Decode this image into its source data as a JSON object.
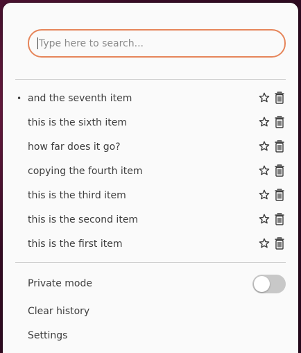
{
  "search": {
    "placeholder": "Type here to search..."
  },
  "history": {
    "items": [
      {
        "label": "and the seventh item",
        "current": true
      },
      {
        "label": "this is the sixth item",
        "current": false
      },
      {
        "label": "how far does it go?",
        "current": false
      },
      {
        "label": "copying the fourth item",
        "current": false
      },
      {
        "label": "this is the third item",
        "current": false
      },
      {
        "label": "this is the second item",
        "current": false
      },
      {
        "label": "this is the first item",
        "current": false
      }
    ],
    "current_marker": "•"
  },
  "menu": {
    "private_mode_label": "Private mode",
    "private_mode_enabled": false,
    "clear_history_label": "Clear history",
    "settings_label": "Settings"
  },
  "icons": {
    "favorite": "star-outline-icon",
    "delete": "trash-icon"
  },
  "colors": {
    "accent": "#e6855a",
    "text": "#3d3d3d",
    "toggle_off": "#c8c8c8"
  }
}
